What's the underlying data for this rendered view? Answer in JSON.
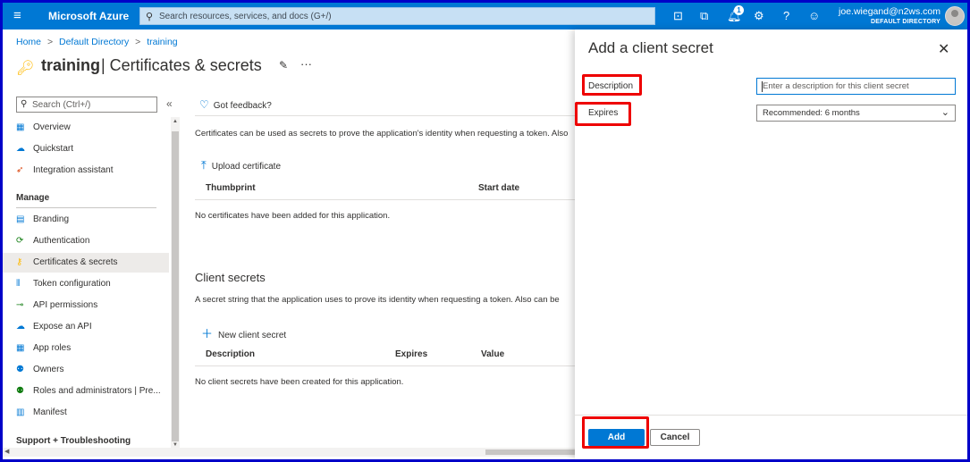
{
  "topbar": {
    "brand": "Microsoft Azure",
    "search_placeholder": "Search resources, services, and docs (G+/)",
    "notification_count": "1",
    "user_email": "joe.wiegand@n2ws.com",
    "user_directory": "DEFAULT DIRECTORY"
  },
  "breadcrumb": {
    "items": [
      "Home",
      "Default Directory",
      "training"
    ],
    "sep": ">"
  },
  "page": {
    "title_bold": "training",
    "title_rest": "| Certificates & secrets"
  },
  "sidebar": {
    "search_placeholder": "Search (Ctrl+/)",
    "collapse": "«",
    "items_top": [
      {
        "label": "Overview",
        "icon": "overview-icon"
      },
      {
        "label": "Quickstart",
        "icon": "quickstart-icon"
      },
      {
        "label": "Integration assistant",
        "icon": "rocket-icon"
      }
    ],
    "manage_heading": "Manage",
    "items_manage": [
      {
        "label": "Branding",
        "icon": "branding-icon"
      },
      {
        "label": "Authentication",
        "icon": "authentication-icon"
      },
      {
        "label": "Certificates & secrets",
        "icon": "key-icon"
      },
      {
        "label": "Token configuration",
        "icon": "token-icon"
      },
      {
        "label": "API permissions",
        "icon": "api-permissions-icon"
      },
      {
        "label": "Expose an API",
        "icon": "cloud-icon"
      },
      {
        "label": "App roles",
        "icon": "app-roles-icon"
      },
      {
        "label": "Owners",
        "icon": "owners-icon"
      },
      {
        "label": "Roles and administrators | Pre...",
        "icon": "roles-icon"
      },
      {
        "label": "Manifest",
        "icon": "manifest-icon"
      }
    ],
    "support_heading": "Support + Troubleshooting",
    "selected": "Certificates & secrets"
  },
  "main": {
    "feedback": "Got feedback?",
    "cert_description": "Certificates can be used as secrets to prove the application's identity when requesting a token. Also",
    "upload_certificate": "Upload certificate",
    "cert_columns": [
      "Thumbprint",
      "Start date"
    ],
    "cert_empty": "No certificates have been added for this application.",
    "secrets_title": "Client secrets",
    "secrets_description": "A secret string that the application uses to prove its identity when requesting a token. Also can be",
    "new_secret": "New client secret",
    "secret_columns": [
      "Description",
      "Expires",
      "Value"
    ],
    "secrets_empty": "No client secrets have been created for this application."
  },
  "panel": {
    "title": "Add a client secret",
    "description_label": "Description",
    "description_placeholder": "Enter a description for this client secret",
    "expires_label": "Expires",
    "expires_value": "Recommended: 6 months",
    "add_button": "Add",
    "cancel_button": "Cancel"
  },
  "colors": {
    "azure_blue": "#0078d4",
    "highlight_red": "#e00000",
    "frame_blue": "#0000c8"
  }
}
